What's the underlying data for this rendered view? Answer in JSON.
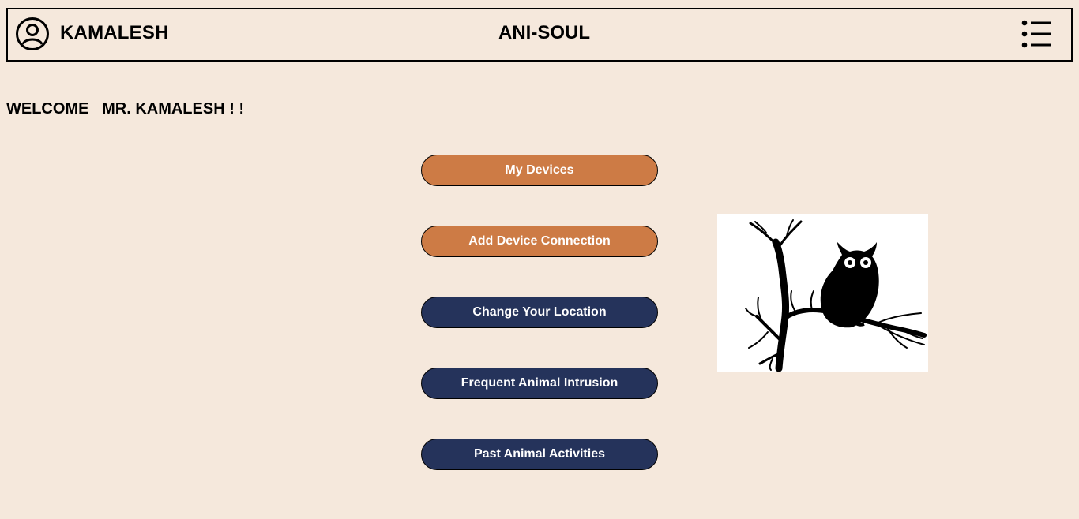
{
  "header": {
    "user_name": "KAMALESH",
    "app_title": "ANI-SOUL"
  },
  "welcome": {
    "text": "WELCOME   MR. KAMALESH ! !"
  },
  "buttons": [
    {
      "label": "My Devices",
      "color": "#cd7b45"
    },
    {
      "label": "Add Device Connection",
      "color": "#cd7b45"
    },
    {
      "label": "Change Your Location",
      "color": "#25335b"
    },
    {
      "label": "Frequent Animal Intrusion",
      "color": "#25335b"
    },
    {
      "label": "Past Animal Activities",
      "color": "#25335b"
    }
  ],
  "image": {
    "subject": "owl-on-branch-silhouette"
  },
  "icons": {
    "user": "user-circle-icon",
    "menu": "list-menu-icon"
  },
  "colors": {
    "background": "#f5e8dc",
    "accent_orange": "#cd7b45",
    "accent_navy": "#25335b"
  }
}
